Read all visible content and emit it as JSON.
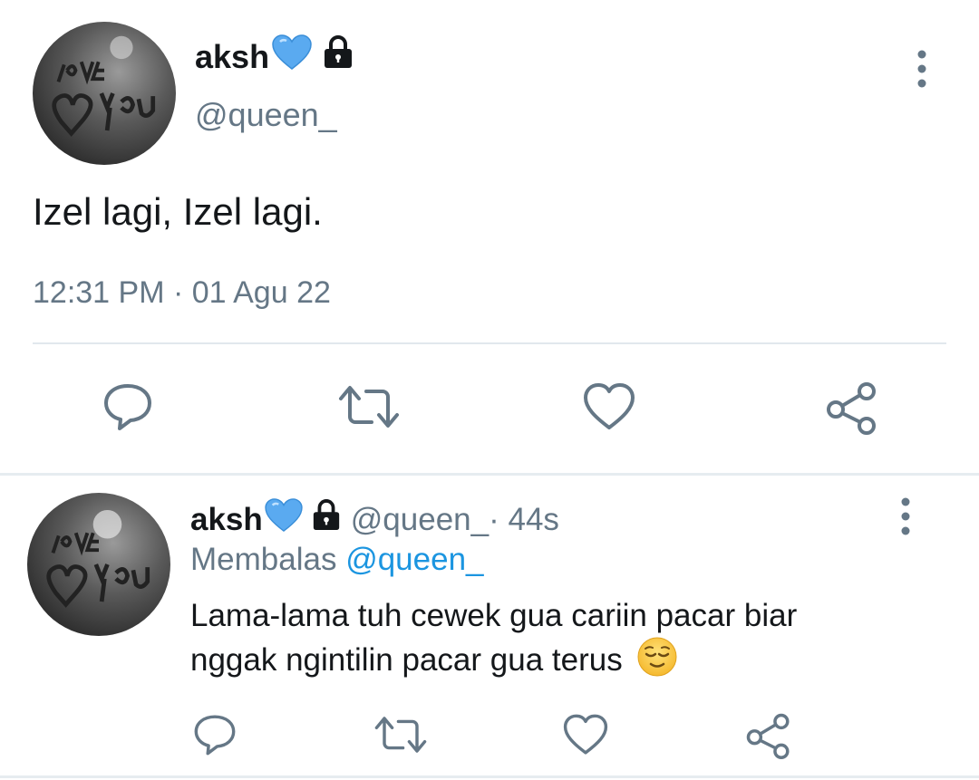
{
  "tweet": {
    "display_name": "aksh",
    "handle": "@queen_",
    "text": "Izel lagi, Izel lagi.",
    "timestamp": "12:31 PM · 01 Agu 22"
  },
  "reply": {
    "display_name": "aksh",
    "handle": "@queen_",
    "age": " · 44s",
    "replying_label": "Membalas",
    "replying_to": "@queen_",
    "text_line1": "Lama-lama tuh cewek gua cariin pacar biar",
    "text_line2": "nggak ngintilin pacar gua terus"
  },
  "icons": {
    "name_emoji": "blue-heart-icon",
    "protected": "lock-icon",
    "overflow": "more-vertical-icon",
    "actions": [
      "reply-icon",
      "retweet-icon",
      "like-icon",
      "share-icon"
    ],
    "reply_emoji": "relieved-face-icon"
  },
  "colors": {
    "muted_text": "#657786",
    "link": "#1b95e0",
    "icon_stroke": "#657786"
  }
}
